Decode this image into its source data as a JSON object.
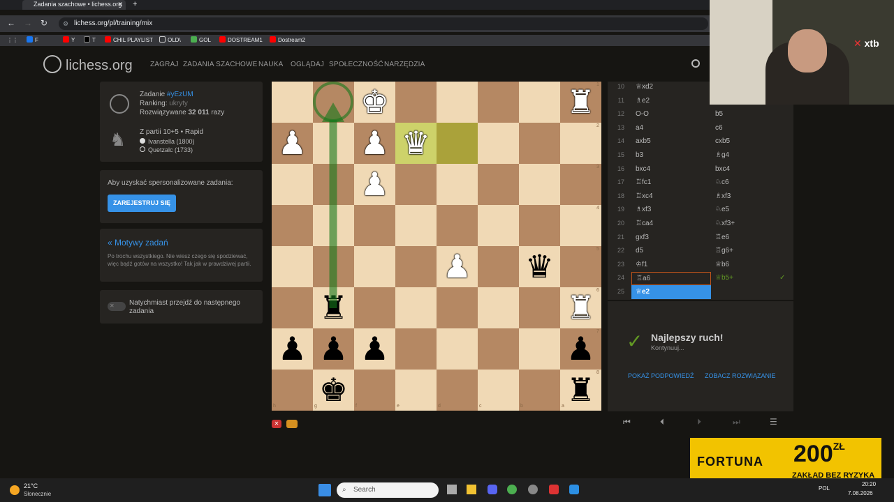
{
  "browser": {
    "tab_title": "Zadania szachowe • lichess.org",
    "tab_close": "✕",
    "new_tab": "+",
    "url": "lichess.org/pl/training/mix",
    "bookmarks": [
      "F",
      "Y",
      "T",
      "CHIL PLAYLIST",
      "OLD\\",
      "GOL",
      "DOSTREAM1",
      "Dostream2"
    ]
  },
  "site": {
    "logo": "lichess.org",
    "nav": [
      "ZAGRAJ",
      "ZADANIA SZACHOWE",
      "NAUKA",
      "OGLĄDAJ",
      "SPOŁECZNOŚĆ",
      "NARZĘDZIA"
    ]
  },
  "puzzle": {
    "label": "Zadanie",
    "id": "#yEzUM",
    "ranking_label": "Ranking:",
    "ranking_value": "ukryty",
    "solved_prefix": "Rozwiązywane",
    "solved_count": "32 011",
    "solved_suffix": "razy",
    "game": "Z partii 10+5 • Rapid",
    "white_player": "Ivanstella (1800)",
    "black_player": "Quetzalc (1733)"
  },
  "signup": {
    "text": "Aby uzyskać spersonalizowane zadania:",
    "button": "ZAREJESTRUJ SIĘ"
  },
  "themes": {
    "title": "« Motywy zadań",
    "desc": "Po trochu wszystkiego. Nie wiesz czego się spodziewać, więc bądź gotów na wszystko! Tak jak w prawdziwej partii."
  },
  "toggle": {
    "label": "Natychmiast przejdź do następnego zadania"
  },
  "moves": [
    {
      "n": "10",
      "w": "♕xd2",
      "b": ""
    },
    {
      "n": "11",
      "w": "♗e2",
      "b": ""
    },
    {
      "n": "12",
      "w": "O-O",
      "b": "b5"
    },
    {
      "n": "13",
      "w": "a4",
      "b": "c6"
    },
    {
      "n": "14",
      "w": "axb5",
      "b": "cxb5"
    },
    {
      "n": "15",
      "w": "b3",
      "b": "♗g4"
    },
    {
      "n": "16",
      "w": "bxc4",
      "b": "bxc4"
    },
    {
      "n": "17",
      "w": "♖fc1",
      "b": "♘c6"
    },
    {
      "n": "18",
      "w": "♖xc4",
      "b": "♗xf3"
    },
    {
      "n": "19",
      "w": "♗xf3",
      "b": "♘e5"
    },
    {
      "n": "20",
      "w": "♖ca4",
      "b": "♘xf3+"
    },
    {
      "n": "21",
      "w": "gxf3",
      "b": "♖e6"
    },
    {
      "n": "22",
      "w": "d5",
      "b": "♖g6+"
    },
    {
      "n": "23",
      "w": "♔f1",
      "b": "♕b6"
    },
    {
      "n": "24",
      "w": "♖a6",
      "b": "♕b5+"
    },
    {
      "n": "25",
      "w": "♕e2",
      "b": ""
    }
  ],
  "feedback": {
    "title": "Najlepszy ruch!",
    "sub": "Kontynuuj...",
    "hint": "POKAŻ PODPOWIEDŹ",
    "solution": "ZOBACZ ROZWIĄZANIE",
    "checkmark": "✓"
  },
  "board": {
    "files": [
      "h",
      "g",
      "f",
      "e",
      "d",
      "c",
      "b",
      "a"
    ],
    "ranks": [
      "1",
      "2",
      "3",
      "4",
      "5",
      "6",
      "7",
      "8"
    ],
    "pieces": [
      {
        "sq": "f1",
        "p": "♚",
        "c": "w"
      },
      {
        "sq": "a1",
        "p": "♜",
        "c": "w"
      },
      {
        "sq": "h2",
        "p": "♟",
        "c": "w"
      },
      {
        "sq": "f2",
        "p": "♟",
        "c": "w"
      },
      {
        "sq": "e2",
        "p": "♛",
        "c": "w"
      },
      {
        "sq": "f3",
        "p": "♟",
        "c": "w"
      },
      {
        "sq": "d5",
        "p": "♟",
        "c": "w"
      },
      {
        "sq": "b5",
        "p": "♛",
        "c": "b"
      },
      {
        "sq": "g6",
        "p": "♜",
        "c": "b"
      },
      {
        "sq": "a6",
        "p": "♜",
        "c": "w"
      },
      {
        "sq": "h7",
        "p": "♟",
        "c": "b"
      },
      {
        "sq": "g7",
        "p": "♟",
        "c": "b"
      },
      {
        "sq": "f7",
        "p": "♟",
        "c": "b"
      },
      {
        "sq": "a7",
        "p": "♟",
        "c": "b"
      },
      {
        "sq": "g8",
        "p": "♚",
        "c": "b"
      },
      {
        "sq": "a8",
        "p": "♜",
        "c": "b"
      }
    ]
  },
  "overlay": {
    "brand": "xtb",
    "ad_brand": "FORTUNA",
    "ad_amount": "200",
    "ad_currency": "ZŁ",
    "ad_text": "ZAKŁAD BEZ RYZYKA"
  },
  "taskbar": {
    "temp": "21°C",
    "weather": "Słonecznie",
    "search": "Search",
    "lang": "POL",
    "time": "20:20",
    "date": "7.08.2026"
  }
}
